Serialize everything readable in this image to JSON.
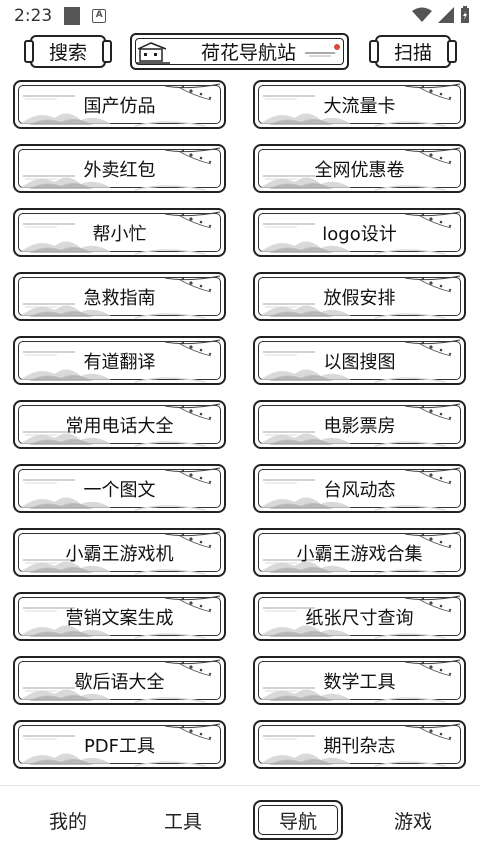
{
  "status_bar": {
    "time": "2:23"
  },
  "header": {
    "search_label": "搜索",
    "title": "荷花导航站",
    "scan_label": "扫描"
  },
  "grid": {
    "items": [
      "国产仿品",
      "大流量卡",
      "外卖红包",
      "全网优惠卷",
      "帮小忙",
      "logo设计",
      "急救指南",
      "放假安排",
      "有道翻译",
      "以图搜图",
      "常用电话大全",
      "电影票房",
      "一个图文",
      "台风动态",
      "小霸王游戏机",
      "小霸王游戏合集",
      "营销文案生成",
      "纸张尺寸查询",
      "歇后语大全",
      "数学工具",
      "PDF工具",
      "期刊杂志"
    ]
  },
  "bottom_nav": {
    "items": [
      "我的",
      "工具",
      "导航",
      "游戏"
    ],
    "active": "导航"
  }
}
